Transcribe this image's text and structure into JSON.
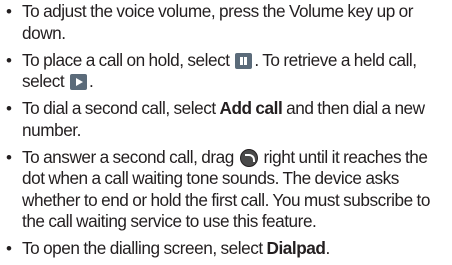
{
  "bullet_symbol": "•",
  "icons": {
    "hold": "pause-icon",
    "retrieve": "play-icon",
    "answer": "call-handle-icon"
  },
  "items": [
    {
      "text": "To adjust the voice volume, press the Volume key up or down."
    },
    {
      "before_hold_icon": "To place a call on hold, select ",
      "between_icons": ". To retrieve a held call, select ",
      "after_retrieve_icon": "."
    },
    {
      "before_bold": "To dial a second call, select ",
      "bold": "Add call",
      "after_bold": " and then dial a new number."
    },
    {
      "before_icon": "To answer a second call, drag ",
      "after_icon": " right until it reaches the dot when a call waiting tone sounds. The device asks whether to end or hold the first call. You must subscribe to the call waiting service to use this feature."
    },
    {
      "before_bold": "To open the dialling screen, select ",
      "bold": "Dialpad",
      "after_bold": "."
    }
  ]
}
